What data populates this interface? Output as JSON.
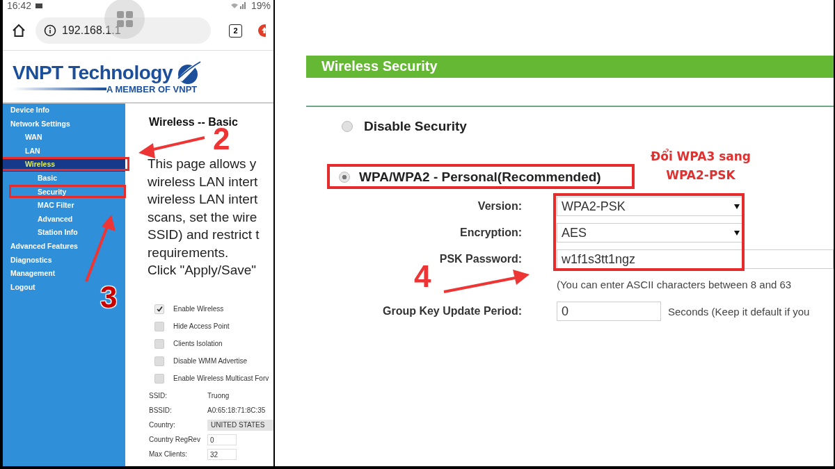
{
  "phone_status_bar": {
    "time": "16:42",
    "battery": "19%"
  },
  "browser": {
    "url": "192.168.1.1",
    "tab_count": "2"
  },
  "logo": {
    "title": "VNPT Technology",
    "tagline": "A MEMBER OF VNPT"
  },
  "sidebar": {
    "items": [
      {
        "label": "Device Info",
        "selected": false
      },
      {
        "label": "Network Settings",
        "selected": false,
        "children": [
          {
            "label": "WAN",
            "selected": false
          },
          {
            "label": "LAN",
            "selected": false
          },
          {
            "label": "Wireless",
            "selected": true,
            "children": [
              {
                "label": "Basic",
                "selected": false
              },
              {
                "label": "Security",
                "selected": false
              },
              {
                "label": "MAC Filter",
                "selected": false
              },
              {
                "label": "Advanced",
                "selected": false
              },
              {
                "label": "Station Info",
                "selected": false
              }
            ]
          }
        ]
      },
      {
        "label": "Advanced Features",
        "selected": false
      },
      {
        "label": "Diagnostics",
        "selected": false
      },
      {
        "label": "Management",
        "selected": false
      },
      {
        "label": "Logout",
        "selected": false
      }
    ]
  },
  "basic_page": {
    "title": "Wireless -- Basic",
    "description_lines": [
      "This page allows y",
      "wireless LAN intert",
      "wireless LAN intert",
      "scans, set the wire",
      "SSID) and restrict t",
      "requirements.",
      "Click \"Apply/Save\""
    ],
    "checkboxes": [
      {
        "label": "Enable Wireless",
        "checked": true
      },
      {
        "label": "Hide Access Point",
        "checked": false
      },
      {
        "label": "Clients Isolation",
        "checked": false
      },
      {
        "label": "Disable WMM Advertise",
        "checked": false
      },
      {
        "label": "Enable Wireless Multicast Forv",
        "checked": false
      }
    ],
    "fields": [
      {
        "label": "SSID:",
        "value": "Truong",
        "kind": "plain"
      },
      {
        "label": "BSSID:",
        "value": "A0:65:18:71:8C:35",
        "kind": "plain"
      },
      {
        "label": "Country:",
        "value": "UNITED STATES",
        "kind": "select"
      },
      {
        "label": "Country RegRev",
        "value": "0",
        "kind": "input"
      },
      {
        "label": "Max Clients:",
        "value": "32",
        "kind": "input"
      }
    ]
  },
  "annotations": [
    {
      "text": "2"
    },
    {
      "text": "3"
    },
    {
      "text": "4"
    }
  ],
  "note": {
    "lines": [
      "Đổi WPA3 sang",
      "WPA2-PSK"
    ]
  },
  "security_page": {
    "title": "Wireless Security",
    "options": [
      {
        "label": "Disable Security",
        "selected": false
      },
      {
        "label": "WPA/WPA2 - Personal(Recommended)",
        "selected": true
      }
    ],
    "fields": [
      {
        "label": "Version:",
        "value": "WPA2-PSK",
        "kind": "select"
      },
      {
        "label": "Encryption:",
        "value": "AES",
        "kind": "select"
      },
      {
        "label": "PSK Password:",
        "value": "w1f1s3tt1ngz",
        "kind": "password",
        "hint": "(You can enter ASCII characters between 8 and 63"
      },
      {
        "label": "Group Key Update Period:",
        "value": "0",
        "kind": "short",
        "suffix": "Seconds (Keep it default if you"
      }
    ]
  }
}
